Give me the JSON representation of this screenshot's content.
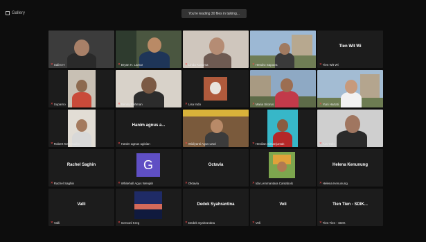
{
  "topbar": {
    "view_label": "Gallery",
    "banner_text": "You're leading 30 files in talking..."
  },
  "tiles": [
    {
      "name": "Salim H",
      "video": "on",
      "big": ""
    },
    {
      "name": "Bryan H. Lamar",
      "video": "on",
      "big": ""
    },
    {
      "name": "Linda Kusuma",
      "video": "on",
      "big": ""
    },
    {
      "name": "Hendro Saputra",
      "video": "on",
      "big": ""
    },
    {
      "name": "Tien Wit Wi",
      "video": "off",
      "big": "Tien Wit Wi"
    },
    {
      "name": "Suparno",
      "video": "on",
      "big": ""
    },
    {
      "name": "Benny Rahman",
      "video": "on",
      "big": ""
    },
    {
      "name": "Lisa Indo",
      "video": "on",
      "big": ""
    },
    {
      "name": "Maria Sitorus",
      "video": "on",
      "big": ""
    },
    {
      "name": "Yuni Hartati",
      "video": "on",
      "big": ""
    },
    {
      "name": "Robert Kertosudiro",
      "video": "on",
      "big": ""
    },
    {
      "name": "Hanim agnus ugisian",
      "video": "off",
      "big": "Hanim agnus a..."
    },
    {
      "name": "Widiyanti Agus Lewi",
      "video": "on",
      "big": ""
    },
    {
      "name": "Herdian Simanjuntak",
      "video": "on",
      "big": ""
    },
    {
      "name": "Ara Yulis",
      "video": "on",
      "big": ""
    },
    {
      "name": "Rachel Saghin",
      "video": "off",
      "big": "Rachel Saghin"
    },
    {
      "name": "Whitehall Agus Wenjah",
      "video": "avatar",
      "big": "G"
    },
    {
      "name": "Oktavia",
      "video": "off",
      "big": "Octavia"
    },
    {
      "name": "Ida Lemmantara Cantabolo",
      "video": "on",
      "big": ""
    },
    {
      "name": "Helena Kenunung",
      "video": "off",
      "big": "Helena Kenunung"
    },
    {
      "name": "Valli",
      "video": "off",
      "big": "Valli"
    },
    {
      "name": "Gersonl Kreg",
      "video": "on",
      "big": ""
    },
    {
      "name": "Dedek Syahrantina",
      "video": "off",
      "big": "Dedek Syahrantina"
    },
    {
      "name": "Veli",
      "video": "off",
      "big": "Veli"
    },
    {
      "name": "Tien Tien - SDIK",
      "video": "off",
      "big": "Tien Tien - SDIK..."
    }
  ]
}
